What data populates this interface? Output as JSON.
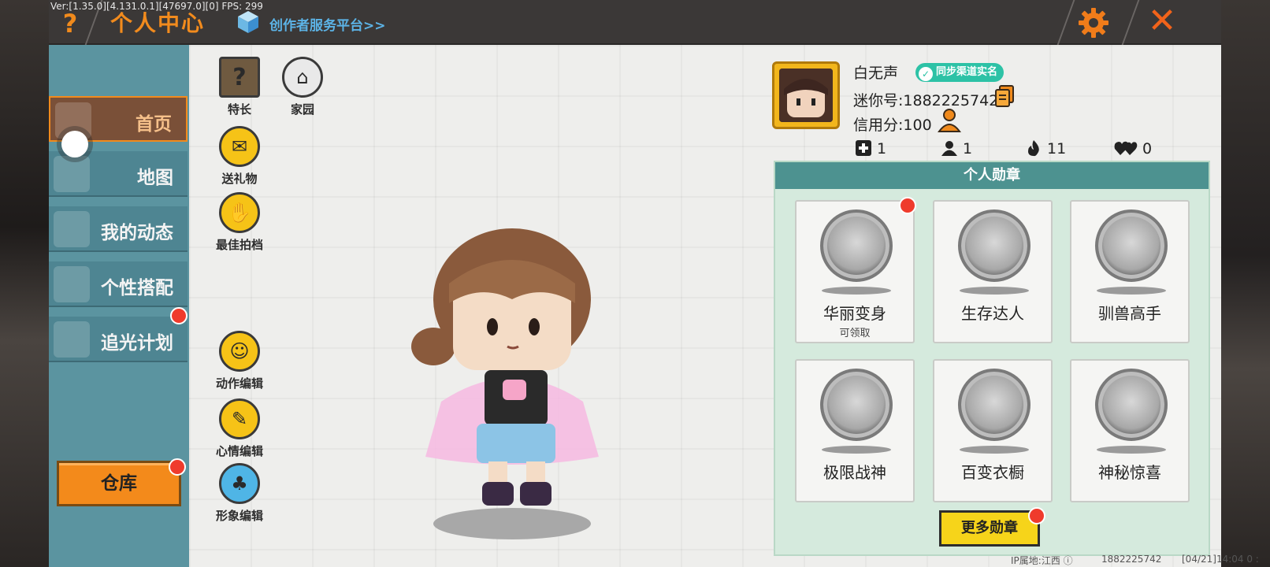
{
  "debug": {
    "version_text": "Ver:[1.35.0][4.131.0.1][47697.0][0] FPS: 299"
  },
  "header": {
    "help_label": "?",
    "title": "个人中心",
    "creator_link": "创作者服务平台>>",
    "close_label": "✕"
  },
  "sidebar": {
    "items": [
      {
        "label": "首页",
        "active": true
      },
      {
        "label": "地图",
        "active": false
      },
      {
        "label": "我的动态",
        "active": false
      },
      {
        "label": "个性搭配",
        "active": false
      },
      {
        "label": "追光计划",
        "active": false,
        "badge": true
      }
    ],
    "warehouse_label": "仓库"
  },
  "functions": {
    "top": [
      {
        "label": "特长",
        "icon": "question-box-icon"
      },
      {
        "label": "家园",
        "icon": "home-icon"
      }
    ],
    "column": [
      {
        "label": "送礼物",
        "icon": "gift-icon"
      },
      {
        "label": "最佳拍档",
        "icon": "handshake-icon"
      },
      {
        "label": "动作编辑",
        "icon": "robot-icon"
      },
      {
        "label": "心情编辑",
        "icon": "pencil-icon"
      },
      {
        "label": "形象编辑",
        "icon": "outfit-icon"
      }
    ]
  },
  "profile": {
    "name": "白无声",
    "realname_badge": "同步渠道实名",
    "mini_id": "迷你号:1882225742",
    "credit": "信用分:100",
    "stats": [
      {
        "icon": "add-friend-icon",
        "value": "1"
      },
      {
        "icon": "fans-icon",
        "value": "1"
      },
      {
        "icon": "fire-icon",
        "value": "11"
      },
      {
        "icon": "hearts-icon",
        "value": "0"
      }
    ]
  },
  "medals": {
    "header": "个人勋章",
    "items": [
      {
        "name": "华丽变身",
        "sub": "可领取",
        "icon": "transform-medal-icon",
        "badge": true
      },
      {
        "name": "生存达人",
        "sub": "",
        "icon": "campfire-medal-icon",
        "badge": false
      },
      {
        "name": "驯兽高手",
        "sub": "",
        "icon": "horse-medal-icon",
        "badge": false
      },
      {
        "name": "极限战神",
        "sub": "",
        "icon": "boss-medal-icon",
        "badge": false
      },
      {
        "name": "百变衣橱",
        "sub": "",
        "icon": "wardrobe-medal-icon",
        "badge": false
      },
      {
        "name": "神秘惊喜",
        "sub": "",
        "icon": "giftbox-medal-icon",
        "badge": false
      }
    ],
    "more_label": "更多勋章"
  },
  "footer": {
    "ip_location": "IP属地:江西",
    "account": "1882225742",
    "timestamp": "[04/21]14:04 0 :"
  },
  "colors": {
    "accent_orange": "#f28b1d",
    "sidebar_teal": "#5b94a0",
    "panel_header_teal": "#4d9290",
    "badge_red": "#ef3b2c",
    "button_yellow": "#f6d41a"
  }
}
